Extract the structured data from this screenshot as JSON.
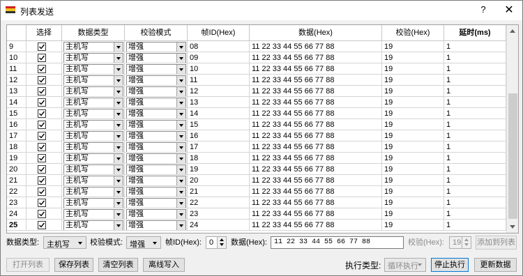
{
  "window": {
    "title": "列表发送",
    "help_glyph": "?",
    "close_glyph": "✕"
  },
  "table": {
    "headers": [
      "选择",
      "数据类型",
      "校验模式",
      "帧ID(Hex)",
      "数据(Hex)",
      "校验(Hex)",
      "延时(ms)"
    ],
    "rows": [
      {
        "no": "9",
        "type": "主机写",
        "mode": "增强",
        "id": "08",
        "data": "11 22 33 44 55 66 77 88",
        "check": "19",
        "delay": "1"
      },
      {
        "no": "10",
        "type": "主机写",
        "mode": "增强",
        "id": "09",
        "data": "11 22 33 44 55 66 77 88",
        "check": "19",
        "delay": "1"
      },
      {
        "no": "11",
        "type": "主机写",
        "mode": "增强",
        "id": "10",
        "data": "11 22 33 44 55 66 77 88",
        "check": "19",
        "delay": "1"
      },
      {
        "no": "12",
        "type": "主机写",
        "mode": "增强",
        "id": "11",
        "data": "11 22 33 44 55 66 77 88",
        "check": "19",
        "delay": "1"
      },
      {
        "no": "13",
        "type": "主机写",
        "mode": "增强",
        "id": "12",
        "data": "11 22 33 44 55 66 77 88",
        "check": "19",
        "delay": "1"
      },
      {
        "no": "14",
        "type": "主机写",
        "mode": "增强",
        "id": "13",
        "data": "11 22 33 44 55 66 77 88",
        "check": "19",
        "delay": "1"
      },
      {
        "no": "15",
        "type": "主机写",
        "mode": "增强",
        "id": "14",
        "data": "11 22 33 44 55 66 77 88",
        "check": "19",
        "delay": "1"
      },
      {
        "no": "16",
        "type": "主机写",
        "mode": "增强",
        "id": "15",
        "data": "11 22 33 44 55 66 77 88",
        "check": "19",
        "delay": "1"
      },
      {
        "no": "17",
        "type": "主机写",
        "mode": "增强",
        "id": "16",
        "data": "11 22 33 44 55 66 77 88",
        "check": "19",
        "delay": "1"
      },
      {
        "no": "18",
        "type": "主机写",
        "mode": "增强",
        "id": "17",
        "data": "11 22 33 44 55 66 77 88",
        "check": "19",
        "delay": "1"
      },
      {
        "no": "19",
        "type": "主机写",
        "mode": "增强",
        "id": "18",
        "data": "11 22 33 44 55 66 77 88",
        "check": "19",
        "delay": "1"
      },
      {
        "no": "20",
        "type": "主机写",
        "mode": "增强",
        "id": "19",
        "data": "11 22 33 44 55 66 77 88",
        "check": "19",
        "delay": "1"
      },
      {
        "no": "21",
        "type": "主机写",
        "mode": "增强",
        "id": "20",
        "data": "11 22 33 44 55 66 77 88",
        "check": "19",
        "delay": "1"
      },
      {
        "no": "22",
        "type": "主机写",
        "mode": "增强",
        "id": "21",
        "data": "11 22 33 44 55 66 77 88",
        "check": "19",
        "delay": "1"
      },
      {
        "no": "23",
        "type": "主机写",
        "mode": "增强",
        "id": "22",
        "data": "11 22 33 44 55 66 77 88",
        "check": "19",
        "delay": "1"
      },
      {
        "no": "24",
        "type": "主机写",
        "mode": "增强",
        "id": "23",
        "data": "11 22 33 44 55 66 77 88",
        "check": "19",
        "delay": "1"
      },
      {
        "no": "25",
        "type": "主机写",
        "mode": "增强",
        "id": "24",
        "data": "11 22 33 44 55 66 77 88",
        "check": "19",
        "delay": "1"
      }
    ],
    "current_row": "25"
  },
  "edit": {
    "type_label": "数据类型:",
    "type_value": "主机写",
    "mode_label": "校验模式:",
    "mode_value": "增强",
    "id_label": "帧ID(Hex):",
    "id_value": "0",
    "data_label": "数据(Hex):",
    "data_value": "11 22 33 44 55 66 77 88",
    "check_label": "校验(Hex):",
    "check_value": "19",
    "add_button": "添加到列表"
  },
  "footer": {
    "open_list": "打开列表",
    "save_list": "保存列表",
    "clear_list": "清空列表",
    "offline_write": "离线写入",
    "exec_label": "执行类型:",
    "exec_value": "循环执行",
    "stop_button": "停止执行",
    "update_button": "更新数据"
  },
  "colors": {
    "app_icon_red": "#d42020",
    "app_icon_yellow": "#f0c020",
    "focus_border": "#0078d7"
  }
}
